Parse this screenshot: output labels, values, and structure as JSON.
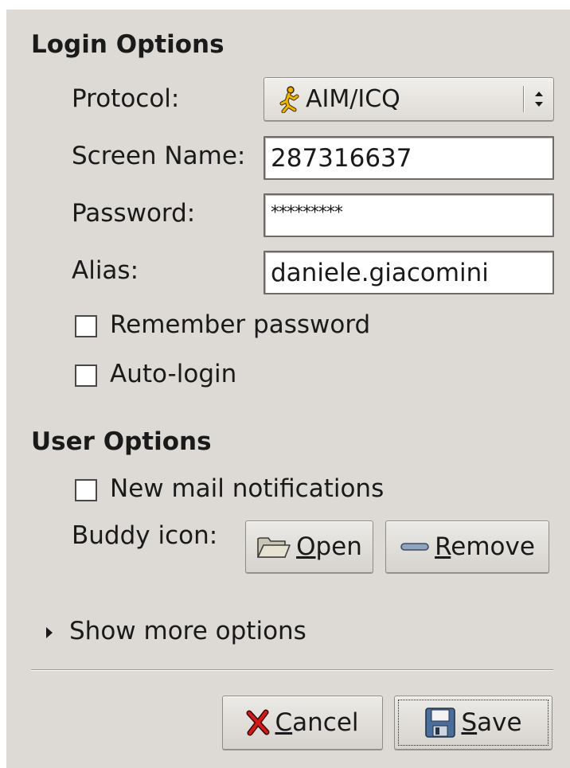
{
  "login_options": {
    "title": "Login Options",
    "protocol": {
      "label": "Protocol:",
      "value": "AIM/ICQ",
      "icon": "aim-running-man-icon"
    },
    "screen_name": {
      "label": "Screen Name:",
      "value": "287316637"
    },
    "password": {
      "label": "Password:",
      "value": "*********"
    },
    "alias": {
      "label": "Alias:",
      "value": "daniele.giacomini"
    },
    "remember_password": {
      "label": "Remember password",
      "checked": false
    },
    "auto_login": {
      "label": "Auto-login",
      "checked": false
    }
  },
  "user_options": {
    "title": "User Options",
    "new_mail": {
      "label": "New mail notifications",
      "checked": false
    },
    "buddy_icon": {
      "label": "Buddy icon:",
      "open_mnemonic": "O",
      "open_rest": "pen",
      "remove_mnemonic": "R",
      "remove_rest": "emove"
    }
  },
  "more_options": {
    "label": "Show more options"
  },
  "footer": {
    "cancel_mnemonic": "C",
    "cancel_rest": "ancel",
    "save_mnemonic": "S",
    "save_rest": "ave"
  },
  "colors": {
    "dialog_bg": "#dddad5",
    "aim_yellow": "#f0b400"
  }
}
